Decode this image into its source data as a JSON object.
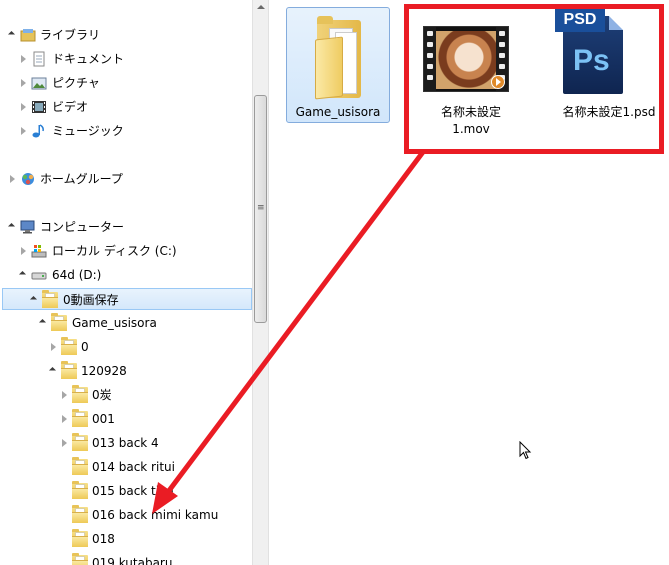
{
  "nav": {
    "items": [
      {
        "label": "ライブラリ",
        "icon": "library-icon",
        "level": 0,
        "expander": "open"
      },
      {
        "label": "ドキュメント",
        "icon": "documents-icon",
        "level": 1,
        "expander": "closed"
      },
      {
        "label": "ピクチャ",
        "icon": "pictures-icon",
        "level": 1,
        "expander": "closed"
      },
      {
        "label": "ビデオ",
        "icon": "videos-icon",
        "level": 1,
        "expander": "closed"
      },
      {
        "label": "ミュージック",
        "icon": "music-icon",
        "level": 1,
        "expander": "closed"
      },
      {
        "label": "ホームグループ",
        "icon": "homegroup-icon",
        "level": 0,
        "expander": "closed"
      },
      {
        "label": "コンピューター",
        "icon": "computer-icon",
        "level": 0,
        "expander": "open"
      },
      {
        "label": "ローカル ディスク (C:)",
        "icon": "local-disk-icon",
        "level": 1,
        "expander": "closed"
      },
      {
        "label": "64d (D:)",
        "icon": "drive-icon",
        "level": 1,
        "expander": "open"
      },
      {
        "label": "0動画保存",
        "icon": "folder-icon",
        "level": 2,
        "expander": "open",
        "selected": true
      },
      {
        "label": "Game_usisora",
        "icon": "folder-icon",
        "level": 3,
        "expander": "open"
      },
      {
        "label": "0",
        "icon": "folder-icon",
        "level": 4,
        "expander": "closed"
      },
      {
        "label": "120928",
        "icon": "folder-icon",
        "level": 4,
        "expander": "open"
      },
      {
        "label": "0炭",
        "icon": "folder-icon",
        "level": 5,
        "expander": "closed"
      },
      {
        "label": "001",
        "icon": "folder-icon",
        "level": 5,
        "expander": "closed"
      },
      {
        "label": "013 back 4",
        "icon": "folder-icon",
        "level": 5,
        "expander": "closed"
      },
      {
        "label": "014 back ritui",
        "icon": "folder-icon",
        "level": 5,
        "expander": "none"
      },
      {
        "label": "015 back ti...i",
        "icon": "folder-icon",
        "level": 5,
        "expander": "none"
      },
      {
        "label": "016 back mimi kamu",
        "icon": "folder-icon",
        "level": 5,
        "expander": "none"
      },
      {
        "label": "018",
        "icon": "folder-icon",
        "level": 5,
        "expander": "none"
      },
      {
        "label": "019 kutabaru",
        "icon": "folder-icon",
        "level": 5,
        "expander": "none"
      }
    ]
  },
  "content": {
    "items": [
      {
        "label": "Game_usisora",
        "icon": "folder-icon",
        "selected": true
      },
      {
        "label": "名称未設定 1.mov",
        "icon": "video-icon",
        "line1": "名称未設定",
        "line2": "1.mov"
      },
      {
        "label": "名称未設定1.psd",
        "icon": "psd-icon",
        "badge": "PSD",
        "mark": "Ps"
      }
    ]
  },
  "scrollbar": {
    "grip": "≡"
  },
  "colors": {
    "annotation": "#ea1c24",
    "selection": "#cce4f7",
    "folder": "#e8bd45"
  }
}
